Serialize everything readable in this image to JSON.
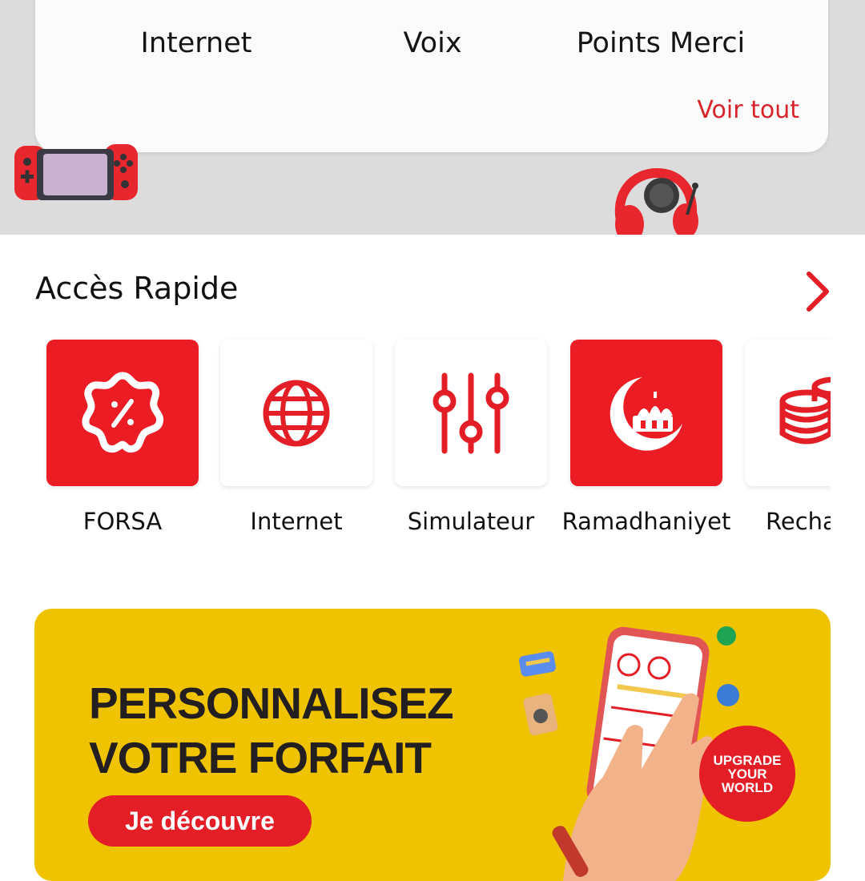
{
  "balance": {
    "gauges": [
      {
        "label": "Internet",
        "ring_color": "#3cc9b0"
      },
      {
        "label": "Voix",
        "ring_color": "#e9e9e9"
      },
      {
        "label": "Points Merci",
        "ring_color": "#e9e9e9"
      }
    ],
    "see_all_label": "Voir tout"
  },
  "quick_access": {
    "title": "Accès Rapide",
    "items": [
      {
        "label": "FORSA",
        "icon": "discount-badge-icon",
        "style": "red"
      },
      {
        "label": "Internet",
        "icon": "globe-icon",
        "style": "white"
      },
      {
        "label": "Simulateur",
        "icon": "sliders-icon",
        "style": "white"
      },
      {
        "label": "Ramadhaniyet",
        "icon": "crescent-mosque-icon",
        "style": "red"
      },
      {
        "label": "Recha",
        "icon": "coins-icon",
        "style": "white"
      }
    ]
  },
  "promo": {
    "title_line1": "PERSONNALISEZ",
    "title_line2": "VOTRE FORFAIT",
    "cta_label": "Je découvre",
    "badge_line1": "UPGRADE",
    "badge_line2": "YOUR",
    "badge_line3": "WORLD"
  },
  "colors": {
    "accent": "#e41e26",
    "banner": "#f0c300",
    "teal": "#3cc9b0"
  }
}
